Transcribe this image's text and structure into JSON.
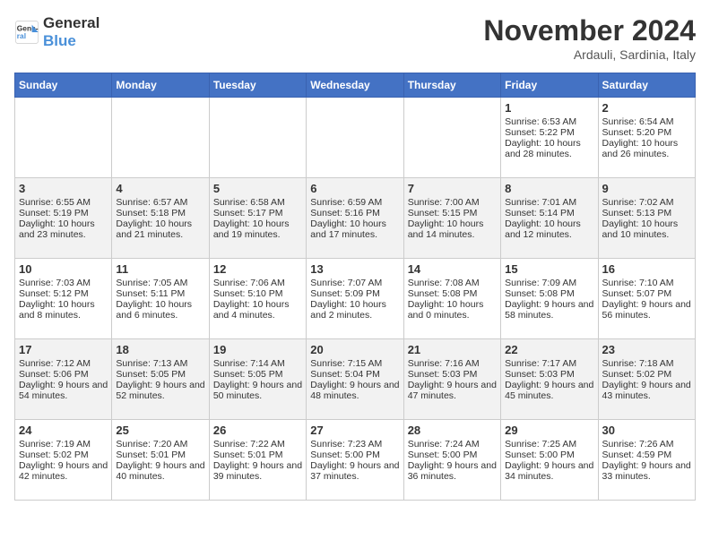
{
  "logo": {
    "line1": "General",
    "line2": "Blue"
  },
  "title": "November 2024",
  "subtitle": "Ardauli, Sardinia, Italy",
  "headers": [
    "Sunday",
    "Monday",
    "Tuesday",
    "Wednesday",
    "Thursday",
    "Friday",
    "Saturday"
  ],
  "weeks": [
    [
      {
        "day": "",
        "info": ""
      },
      {
        "day": "",
        "info": ""
      },
      {
        "day": "",
        "info": ""
      },
      {
        "day": "",
        "info": ""
      },
      {
        "day": "",
        "info": ""
      },
      {
        "day": "1",
        "info": "Sunrise: 6:53 AM\nSunset: 5:22 PM\nDaylight: 10 hours and 28 minutes."
      },
      {
        "day": "2",
        "info": "Sunrise: 6:54 AM\nSunset: 5:20 PM\nDaylight: 10 hours and 26 minutes."
      }
    ],
    [
      {
        "day": "3",
        "info": "Sunrise: 6:55 AM\nSunset: 5:19 PM\nDaylight: 10 hours and 23 minutes."
      },
      {
        "day": "4",
        "info": "Sunrise: 6:57 AM\nSunset: 5:18 PM\nDaylight: 10 hours and 21 minutes."
      },
      {
        "day": "5",
        "info": "Sunrise: 6:58 AM\nSunset: 5:17 PM\nDaylight: 10 hours and 19 minutes."
      },
      {
        "day": "6",
        "info": "Sunrise: 6:59 AM\nSunset: 5:16 PM\nDaylight: 10 hours and 17 minutes."
      },
      {
        "day": "7",
        "info": "Sunrise: 7:00 AM\nSunset: 5:15 PM\nDaylight: 10 hours and 14 minutes."
      },
      {
        "day": "8",
        "info": "Sunrise: 7:01 AM\nSunset: 5:14 PM\nDaylight: 10 hours and 12 minutes."
      },
      {
        "day": "9",
        "info": "Sunrise: 7:02 AM\nSunset: 5:13 PM\nDaylight: 10 hours and 10 minutes."
      }
    ],
    [
      {
        "day": "10",
        "info": "Sunrise: 7:03 AM\nSunset: 5:12 PM\nDaylight: 10 hours and 8 minutes."
      },
      {
        "day": "11",
        "info": "Sunrise: 7:05 AM\nSunset: 5:11 PM\nDaylight: 10 hours and 6 minutes."
      },
      {
        "day": "12",
        "info": "Sunrise: 7:06 AM\nSunset: 5:10 PM\nDaylight: 10 hours and 4 minutes."
      },
      {
        "day": "13",
        "info": "Sunrise: 7:07 AM\nSunset: 5:09 PM\nDaylight: 10 hours and 2 minutes."
      },
      {
        "day": "14",
        "info": "Sunrise: 7:08 AM\nSunset: 5:08 PM\nDaylight: 10 hours and 0 minutes."
      },
      {
        "day": "15",
        "info": "Sunrise: 7:09 AM\nSunset: 5:08 PM\nDaylight: 9 hours and 58 minutes."
      },
      {
        "day": "16",
        "info": "Sunrise: 7:10 AM\nSunset: 5:07 PM\nDaylight: 9 hours and 56 minutes."
      }
    ],
    [
      {
        "day": "17",
        "info": "Sunrise: 7:12 AM\nSunset: 5:06 PM\nDaylight: 9 hours and 54 minutes."
      },
      {
        "day": "18",
        "info": "Sunrise: 7:13 AM\nSunset: 5:05 PM\nDaylight: 9 hours and 52 minutes."
      },
      {
        "day": "19",
        "info": "Sunrise: 7:14 AM\nSunset: 5:05 PM\nDaylight: 9 hours and 50 minutes."
      },
      {
        "day": "20",
        "info": "Sunrise: 7:15 AM\nSunset: 5:04 PM\nDaylight: 9 hours and 48 minutes."
      },
      {
        "day": "21",
        "info": "Sunrise: 7:16 AM\nSunset: 5:03 PM\nDaylight: 9 hours and 47 minutes."
      },
      {
        "day": "22",
        "info": "Sunrise: 7:17 AM\nSunset: 5:03 PM\nDaylight: 9 hours and 45 minutes."
      },
      {
        "day": "23",
        "info": "Sunrise: 7:18 AM\nSunset: 5:02 PM\nDaylight: 9 hours and 43 minutes."
      }
    ],
    [
      {
        "day": "24",
        "info": "Sunrise: 7:19 AM\nSunset: 5:02 PM\nDaylight: 9 hours and 42 minutes."
      },
      {
        "day": "25",
        "info": "Sunrise: 7:20 AM\nSunset: 5:01 PM\nDaylight: 9 hours and 40 minutes."
      },
      {
        "day": "26",
        "info": "Sunrise: 7:22 AM\nSunset: 5:01 PM\nDaylight: 9 hours and 39 minutes."
      },
      {
        "day": "27",
        "info": "Sunrise: 7:23 AM\nSunset: 5:00 PM\nDaylight: 9 hours and 37 minutes."
      },
      {
        "day": "28",
        "info": "Sunrise: 7:24 AM\nSunset: 5:00 PM\nDaylight: 9 hours and 36 minutes."
      },
      {
        "day": "29",
        "info": "Sunrise: 7:25 AM\nSunset: 5:00 PM\nDaylight: 9 hours and 34 minutes."
      },
      {
        "day": "30",
        "info": "Sunrise: 7:26 AM\nSunset: 4:59 PM\nDaylight: 9 hours and 33 minutes."
      }
    ]
  ]
}
